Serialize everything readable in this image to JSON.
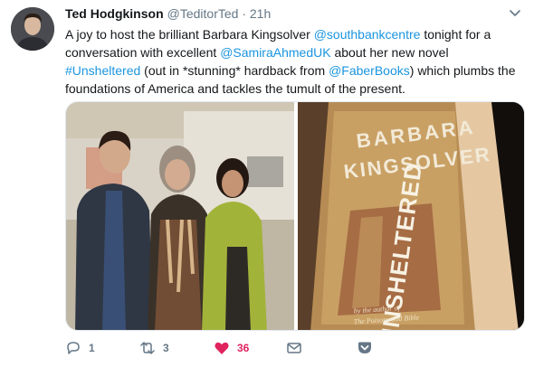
{
  "author": {
    "name": "Ted Hodgkinson",
    "handle": "@TeditorTed",
    "separator": "·",
    "time": "21h"
  },
  "tweet_text": {
    "p1": "A joy to host the brilliant Barbara Kingsolver ",
    "m1": "@southbankcentre",
    "p2": " tonight for a conversation with excellent ",
    "m2": "@SamiraAhmedUK",
    "p3": " about her new novel ",
    "h1": "#Unsheltered",
    "p4": " (out in *stunning* hardback from ",
    "m3": "@FaberBooks",
    "p5": ") which plumbs the foundations of America and tackles the tumult of the present."
  },
  "book_cover": {
    "author_line1": "BARBARA",
    "author_line2": "KINGSOLVER",
    "title": "UNSHELTERED",
    "blurb_line1": "by the author of",
    "blurb_line2": "The Poisonwood Bible"
  },
  "actions": {
    "reply_count": "1",
    "retweet_count": "3",
    "like_count": "36"
  },
  "colors": {
    "link": "#1b95e0",
    "like": "#e0245e",
    "muted": "#657786"
  }
}
